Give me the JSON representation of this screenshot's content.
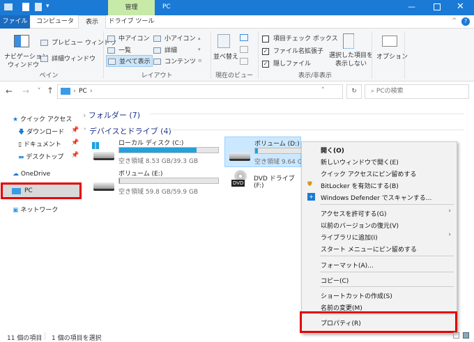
{
  "title": {
    "context_tab": "管理",
    "window_title": "PC"
  },
  "tabs": {
    "file": "ファイル",
    "computer": "コンピューター",
    "view": "表示",
    "drive_tools": "ドライブ ツール"
  },
  "ribbon": {
    "pane": {
      "nav_pane": "ナビゲーション",
      "nav_pane2": "ウィンドウ",
      "preview": "プレビュー ウィンドウ",
      "details": "詳細ウィンドウ",
      "group": "ペイン"
    },
    "layout": {
      "medium": "中アイコン",
      "small": "小アイコン",
      "list": "一覧",
      "details": "詳細",
      "tiles": "並べて表示",
      "content": "コンテンツ",
      "group": "レイアウト"
    },
    "current_view": {
      "sort": "並べ替え",
      "group": "現在のビュー"
    },
    "show_hide": {
      "item_checkbox": "項目チェック ボックス",
      "file_ext": "ファイル名拡張子",
      "hidden": "隠しファイル",
      "hide_selected1": "選択した項目を",
      "hide_selected2": "表示しない",
      "group": "表示/非表示"
    },
    "options": "オプション"
  },
  "address": {
    "path": "PC",
    "search_placeholder": "PCの検索"
  },
  "sidebar": {
    "quick_access": "クイック アクセス",
    "downloads": "ダウンロード",
    "documents": "ドキュメント",
    "desktop": "デスクトップ",
    "onedrive": "OneDrive",
    "pc": "PC",
    "network": "ネットワーク"
  },
  "content": {
    "folders": "フォルダー (7)",
    "devices": "デバイスとドライブ (4)",
    "drives": [
      {
        "name": "ローカル ディスク (C:)",
        "free": "空き領域 8.53 GB/39.3 GB",
        "used_fraction": 0.78
      },
      {
        "name": "ボリューム (D:)",
        "free": "空き領域 9.64 GB",
        "used_fraction": 0.03
      },
      {
        "name": "ボリューム (E:)",
        "free": "空き領域 59.8 GB/59.9 GB",
        "used_fraction": 0.002
      },
      {
        "name": "DVD ドライブ (F:)",
        "badge": "DVD"
      }
    ]
  },
  "menu": [
    "開く(O)",
    "新しいウィンドウで開く(E)",
    "クイック アクセスにピン留めする",
    "BitLocker を有効にする(B)",
    "Windows Defender でスキャンする...",
    "アクセスを許可する(G)",
    "以前のバージョンの復元(V)",
    "ライブラリに追加(I)",
    "スタート メニューにピン留めする",
    "フォーマット(A)...",
    "コピー(C)",
    "ショートカットの作成(S)",
    "名前の変更(M)",
    "プロパティ(R)"
  ],
  "status": {
    "count": "11 個の項目",
    "selected": "1 個の項目を選択"
  },
  "colors": {
    "accent": "#1a7ad6",
    "highlight": "#e40000"
  }
}
